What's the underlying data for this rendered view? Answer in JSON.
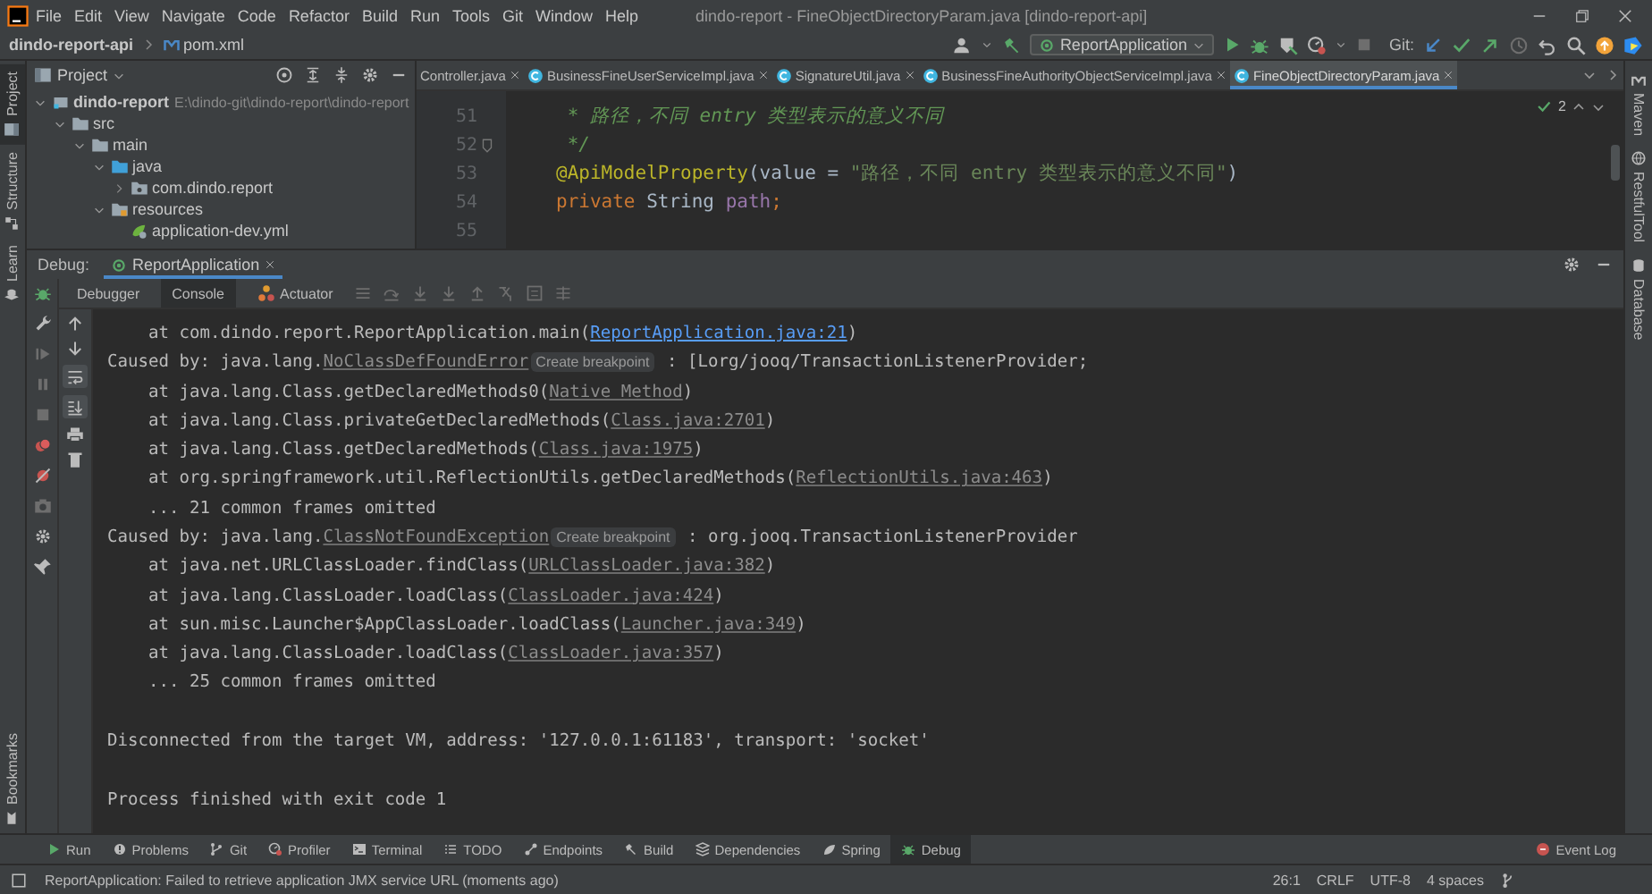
{
  "menu_bar": {
    "items": [
      "File",
      "Edit",
      "View",
      "Navigate",
      "Code",
      "Refactor",
      "Build",
      "Run",
      "Tools",
      "Git",
      "Window",
      "Help"
    ],
    "title": "dindo-report - FineObjectDirectoryParam.java [dindo-report-api]"
  },
  "nav_bar": {
    "breadcrumbs": [
      {
        "label": "dindo-report-api",
        "kind": "module"
      },
      {
        "label": "pom.xml",
        "kind": "maven-file"
      }
    ],
    "run_config": "ReportApplication",
    "git_label": "Git:"
  },
  "left_strip": {
    "top": [
      {
        "label": "Project",
        "selected": true
      },
      {
        "label": "Structure",
        "selected": false
      },
      {
        "label": "Learn",
        "selected": false
      }
    ],
    "bottom": [
      {
        "label": "Bookmarks",
        "selected": false
      }
    ]
  },
  "right_strip": [
    {
      "label": "Maven",
      "kind": "maven"
    },
    {
      "label": "RestfulTool",
      "kind": "globe"
    },
    {
      "label": "Database",
      "kind": "database"
    }
  ],
  "project": {
    "title": "Project",
    "tree": [
      {
        "label": "dindo-report",
        "path": "E:\\dindo-git\\dindo-report\\dindo-report",
        "kind": "module",
        "expanded": true,
        "children": [
          {
            "label": "src",
            "kind": "folder",
            "expanded": true,
            "children": [
              {
                "label": "main",
                "kind": "folder",
                "expanded": true,
                "children": [
                  {
                    "label": "java",
                    "kind": "source",
                    "expanded": true,
                    "children": [
                      {
                        "label": "com.dindo.report",
                        "kind": "package",
                        "expanded": false
                      }
                    ]
                  },
                  {
                    "label": "resources",
                    "kind": "resources",
                    "expanded": true,
                    "children": [
                      {
                        "label": "application-dev.yml",
                        "kind": "yml"
                      }
                    ]
                  }
                ]
              }
            ]
          }
        ]
      }
    ]
  },
  "editor": {
    "tabs": [
      {
        "label": "Controller.java",
        "selected": false,
        "has_icon": false
      },
      {
        "label": "BusinessFineUserServiceImpl.java",
        "selected": false,
        "has_icon": true
      },
      {
        "label": "SignatureUtil.java",
        "selected": false,
        "has_icon": true
      },
      {
        "label": "BusinessFineAuthorityObjectServiceImpl.java",
        "selected": false,
        "has_icon": true
      },
      {
        "label": "FineObjectDirectoryParam.java",
        "selected": true,
        "has_icon": true
      }
    ],
    "inspection_count": "2",
    "lines": [
      {
        "number": "51",
        "fold_marker": false,
        "tokens": [
          {
            "kind": "comment",
            "text": " * 路径，不同 entry 类型表示的意义不同"
          }
        ]
      },
      {
        "number": "52",
        "fold_marker": true,
        "tokens": [
          {
            "kind": "comment",
            "text": " */"
          }
        ]
      },
      {
        "number": "53",
        "fold_marker": false,
        "tokens": [
          {
            "kind": "annotation",
            "text": "@ApiModelProperty"
          },
          {
            "kind": "plain",
            "text": "(value = "
          },
          {
            "kind": "string",
            "text": "\"路径，不同 entry 类型表示的意义不同\""
          },
          {
            "kind": "plain",
            "text": ")"
          }
        ]
      },
      {
        "number": "54",
        "fold_marker": false,
        "tokens": [
          {
            "kind": "keyword",
            "text": "private "
          },
          {
            "kind": "plain",
            "text": "String "
          },
          {
            "kind": "field",
            "text": "path"
          },
          {
            "kind": "keyword",
            "text": ";"
          }
        ]
      },
      {
        "number": "55",
        "fold_marker": false
      }
    ]
  },
  "debug": {
    "label": "Debug:",
    "session": "ReportApplication",
    "tabs": [
      {
        "label": "Debugger",
        "selected": false
      },
      {
        "label": "Console",
        "selected": true
      },
      {
        "label": "Actuator",
        "selected": false
      }
    ],
    "console": [
      {
        "kind": "output",
        "segments": [
          {
            "kind": "text",
            "text": "    at com.dindo.report.ReportApplication.main("
          },
          {
            "kind": "link",
            "text": "ReportApplication.java:21"
          },
          {
            "kind": "text",
            "text": ")"
          }
        ]
      },
      {
        "kind": "output",
        "segments": [
          {
            "kind": "text",
            "text": "Caused by: java.lang."
          },
          {
            "kind": "source",
            "text": "NoClassDefFoundError"
          },
          {
            "kind": "hint",
            "text": "Create breakpoint"
          },
          {
            "kind": "text",
            "text": " : [Lorg/jooq/TransactionListenerProvider;"
          }
        ]
      },
      {
        "kind": "output",
        "segments": [
          {
            "kind": "text",
            "text": "    at java.lang.Class.getDeclaredMethods0("
          },
          {
            "kind": "source",
            "text": "Native Method"
          },
          {
            "kind": "text",
            "text": ")"
          }
        ]
      },
      {
        "kind": "output",
        "segments": [
          {
            "kind": "text",
            "text": "    at java.lang.Class.privateGetDeclaredMethods("
          },
          {
            "kind": "source",
            "text": "Class.java:2701"
          },
          {
            "kind": "text",
            "text": ")"
          }
        ]
      },
      {
        "kind": "output",
        "segments": [
          {
            "kind": "text",
            "text": "    at java.lang.Class.getDeclaredMethods("
          },
          {
            "kind": "source",
            "text": "Class.java:1975"
          },
          {
            "kind": "text",
            "text": ")"
          }
        ]
      },
      {
        "kind": "output",
        "segments": [
          {
            "kind": "text",
            "text": "    at org.springframework.util.ReflectionUtils.getDeclaredMethods("
          },
          {
            "kind": "source",
            "text": "ReflectionUtils.java:463"
          },
          {
            "kind": "text",
            "text": ")"
          }
        ]
      },
      {
        "kind": "output",
        "segments": [
          {
            "kind": "text",
            "text": "    ... 21 common frames omitted"
          }
        ]
      },
      {
        "kind": "output",
        "segments": [
          {
            "kind": "text",
            "text": "Caused by: java.lang."
          },
          {
            "kind": "source",
            "text": "ClassNotFoundException"
          },
          {
            "kind": "hint",
            "text": "Create breakpoint"
          },
          {
            "kind": "text",
            "text": " : org.jooq.TransactionListenerProvider"
          }
        ]
      },
      {
        "kind": "output",
        "segments": [
          {
            "kind": "text",
            "text": "    at java.net.URLClassLoader.findClass("
          },
          {
            "kind": "source",
            "text": "URLClassLoader.java:382"
          },
          {
            "kind": "text",
            "text": ")"
          }
        ]
      },
      {
        "kind": "output",
        "segments": [
          {
            "kind": "text",
            "text": "    at java.lang.ClassLoader.loadClass("
          },
          {
            "kind": "source",
            "text": "ClassLoader.java:424"
          },
          {
            "kind": "text",
            "text": ")"
          }
        ]
      },
      {
        "kind": "output",
        "segments": [
          {
            "kind": "text",
            "text": "    at sun.misc.Launcher$AppClassLoader.loadClass("
          },
          {
            "kind": "source",
            "text": "Launcher.java:349"
          },
          {
            "kind": "text",
            "text": ")"
          }
        ]
      },
      {
        "kind": "output",
        "segments": [
          {
            "kind": "text",
            "text": "    at java.lang.ClassLoader.loadClass("
          },
          {
            "kind": "source",
            "text": "ClassLoader.java:357"
          },
          {
            "kind": "text",
            "text": ")"
          }
        ]
      },
      {
        "kind": "output",
        "segments": [
          {
            "kind": "text",
            "text": "    ... 25 common frames omitted"
          }
        ]
      },
      {
        "kind": "blank"
      },
      {
        "kind": "output",
        "segments": [
          {
            "kind": "text",
            "text": "Disconnected from the target VM, address: '127.0.0.1:61183', transport: 'socket'"
          }
        ]
      },
      {
        "kind": "blank"
      },
      {
        "kind": "output",
        "segments": [
          {
            "kind": "text",
            "text": "Process finished with exit code 1"
          }
        ]
      }
    ]
  },
  "bottom_tabs": [
    {
      "label": "Run",
      "selected": false
    },
    {
      "label": "Problems",
      "selected": false
    },
    {
      "label": "Git",
      "selected": false
    },
    {
      "label": "Profiler",
      "selected": false
    },
    {
      "label": "Terminal",
      "selected": false
    },
    {
      "label": "TODO",
      "selected": false
    },
    {
      "label": "Endpoints",
      "selected": false
    },
    {
      "label": "Build",
      "selected": false
    },
    {
      "label": "Dependencies",
      "selected": false
    },
    {
      "label": "Spring",
      "selected": false
    },
    {
      "label": "Debug",
      "selected": true
    }
  ],
  "event_log": "Event Log",
  "status_bar": {
    "message": "ReportApplication: Failed to retrieve application JMX service URL (moments ago)",
    "items": [
      "26:1",
      "CRLF",
      "UTF-8",
      "4 spaces"
    ]
  }
}
